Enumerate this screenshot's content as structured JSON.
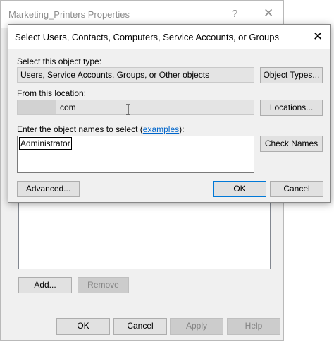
{
  "background_window": {
    "title": "Marketing_Printers Properties",
    "help_glyph": "?",
    "close_glyph": "✕",
    "add_label": "Add...",
    "remove_label": "Remove",
    "ok_label": "OK",
    "cancel_label": "Cancel",
    "apply_label": "Apply",
    "help_label": "Help"
  },
  "dialog": {
    "title": "Select Users, Contacts, Computers, Service Accounts, or Groups",
    "close_glyph": "✕",
    "object_type_label": "Select this object type:",
    "object_type_value": "Users, Service Accounts, Groups, or Other objects",
    "object_types_button": "Object Types...",
    "location_label": "From this location:",
    "location_value": "com",
    "locations_button": "Locations...",
    "names_label_prefix": "Enter the object names to select (",
    "names_label_link": "examples",
    "names_label_suffix": "):",
    "names_value": "Administrator",
    "check_names_button": "Check Names",
    "advanced_button": "Advanced...",
    "ok_button": "OK",
    "cancel_button": "Cancel"
  },
  "colors": {
    "link": "#0066cc",
    "dialog_background": "#f0f0f0",
    "field_readonly": "#e4e4e4"
  }
}
